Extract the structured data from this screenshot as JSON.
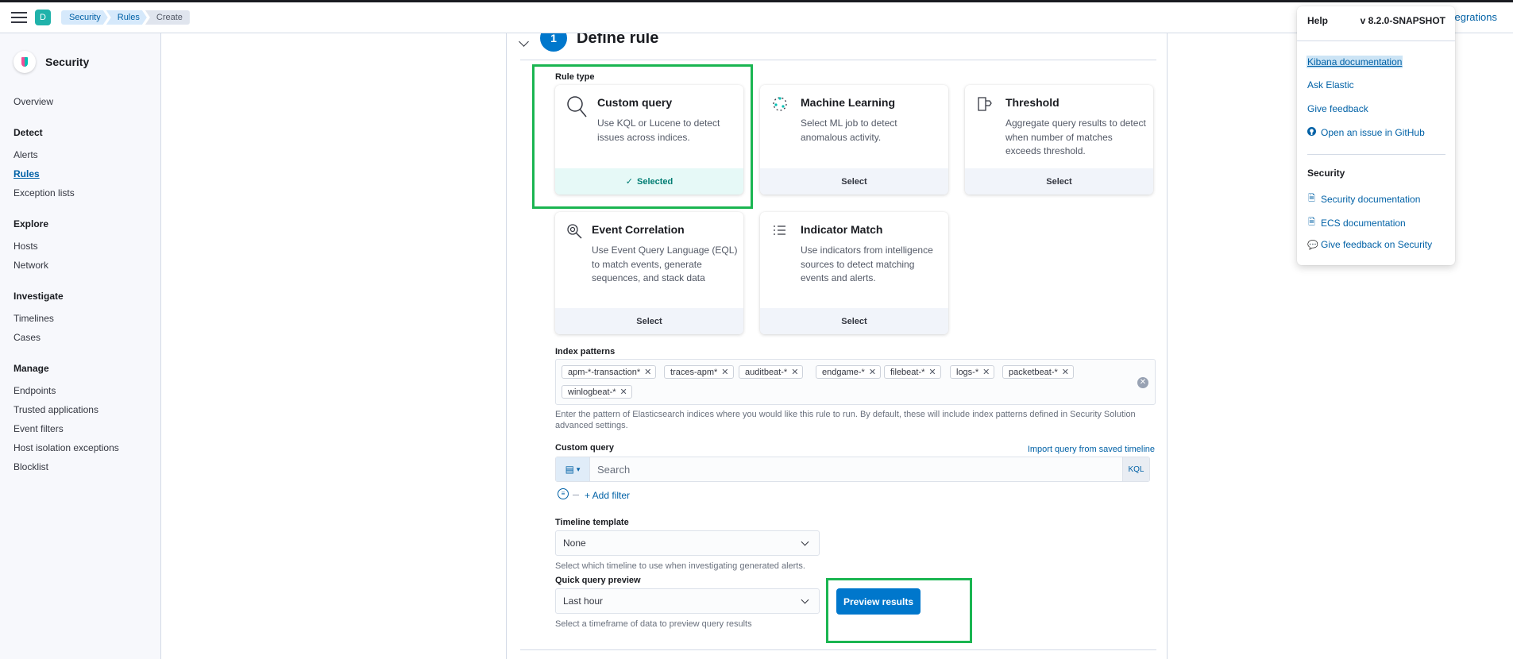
{
  "topbar": {
    "space_initial": "D",
    "breadcrumbs": [
      "Security",
      "Rules",
      "Create"
    ],
    "integrations_link": "egrations"
  },
  "sidebar": {
    "title": "Security",
    "overview": "Overview",
    "groups": [
      {
        "title": "Detect",
        "items": [
          "Alerts",
          "Rules",
          "Exception lists"
        ]
      },
      {
        "title": "Explore",
        "items": [
          "Hosts",
          "Network"
        ]
      },
      {
        "title": "Investigate",
        "items": [
          "Timelines",
          "Cases"
        ]
      },
      {
        "title": "Manage",
        "items": [
          "Endpoints",
          "Trusted applications",
          "Event filters",
          "Host isolation exceptions",
          "Blocklist"
        ]
      }
    ],
    "active_item": "Rules"
  },
  "step": {
    "number": "1",
    "title": "Define rule"
  },
  "rule_type": {
    "label": "Rule type",
    "cards": [
      {
        "title": "Custom query",
        "description": "Use KQL or Lucene to detect issues across indices.",
        "footer": "Selected",
        "icon": "magnifier-icon",
        "selected": true
      },
      {
        "title": "Machine Learning",
        "description": "Select ML job to detect anomalous activity.",
        "footer": "Select",
        "icon": "ml-icon",
        "selected": false
      },
      {
        "title": "Threshold",
        "description": "Aggregate query results to detect when number of matches exceeds threshold.",
        "footer": "Select",
        "icon": "threshold-icon",
        "selected": false
      },
      {
        "title": "Event Correlation",
        "description": "Use Event Query Language (EQL) to match events, generate sequences, and stack data",
        "footer": "Select",
        "icon": "eql-icon",
        "selected": false
      },
      {
        "title": "Indicator Match",
        "description": "Use indicators from intelligence sources to detect matching events and alerts.",
        "footer": "Select",
        "icon": "list-icon",
        "selected": false
      }
    ]
  },
  "index_patterns": {
    "label": "Index patterns",
    "pills": [
      "apm-*-transaction*",
      "traces-apm*",
      "auditbeat-*",
      "endgame-*",
      "filebeat-*",
      "logs-*",
      "packetbeat-*",
      "winlogbeat-*"
    ],
    "help": "Enter the pattern of Elasticsearch indices where you would like this rule to run. By default, these will include index patterns defined in Security Solution advanced settings."
  },
  "custom_query": {
    "label": "Custom query",
    "import_link": "Import query from saved timeline",
    "placeholder": "Search",
    "language": "KQL",
    "add_filter": "+ Add filter"
  },
  "timeline_template": {
    "label": "Timeline template",
    "value": "None",
    "help": "Select which timeline to use when investigating generated alerts."
  },
  "quick_query_preview": {
    "label": "Quick query preview",
    "value": "Last hour",
    "help": "Select a timeframe of data to preview query results",
    "button": "Preview results"
  },
  "help_popover": {
    "title": "Help",
    "version": "v 8.2.0-SNAPSHOT",
    "links": [
      "Kibana documentation",
      "Ask Elastic",
      "Give feedback",
      "Open an issue in GitHub"
    ],
    "section_title": "Security",
    "security_links": [
      "Security documentation",
      "ECS documentation",
      "Give feedback on Security"
    ]
  },
  "colors": {
    "primary": "#0077cc",
    "link": "#0061a6",
    "highlight_box": "#1ab551",
    "selected_footer": "#e6f9f7"
  }
}
